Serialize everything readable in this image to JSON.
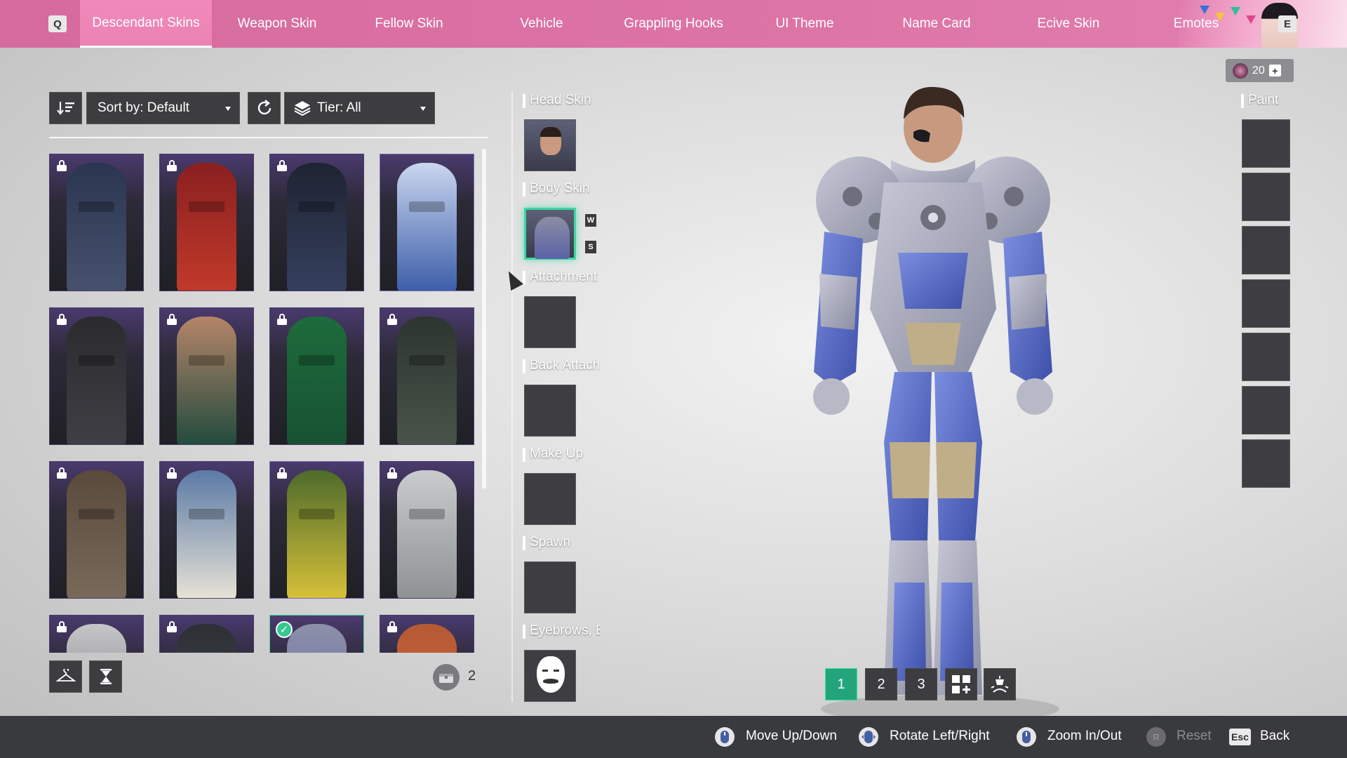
{
  "topbar": {
    "left_key": "Q",
    "right_key": "E",
    "tabs": [
      {
        "label": "Descendant Skins",
        "active": true
      },
      {
        "label": "Weapon Skin",
        "active": false
      },
      {
        "label": "Fellow Skin",
        "active": false
      },
      {
        "label": "Vehicle",
        "active": false
      },
      {
        "label": "Grappling Hooks",
        "active": false
      },
      {
        "label": "UI Theme",
        "active": false
      },
      {
        "label": "Name Card",
        "active": false
      },
      {
        "label": "Ecive Skin",
        "active": false
      },
      {
        "label": "Emotes",
        "active": false
      }
    ]
  },
  "filters": {
    "sort_label": "Sort by: Default",
    "tier_label": "Tier: All"
  },
  "skins": [
    {
      "locked": true,
      "equipped": false,
      "colors": [
        "#2a3550",
        "#47526e"
      ]
    },
    {
      "locked": true,
      "equipped": false,
      "colors": [
        "#8a1f1f",
        "#c23a2a"
      ]
    },
    {
      "locked": true,
      "equipped": false,
      "colors": [
        "#1f2433",
        "#35405e"
      ]
    },
    {
      "locked": false,
      "equipped": false,
      "colors": [
        "#c9d6ee",
        "#3a5ca8"
      ]
    },
    {
      "locked": true,
      "equipped": false,
      "colors": [
        "#2b2b2e",
        "#3f3f45"
      ]
    },
    {
      "locked": true,
      "equipped": false,
      "colors": [
        "#b58568",
        "#1f4a3d"
      ]
    },
    {
      "locked": true,
      "equipped": false,
      "colors": [
        "#1d6b3c",
        "#175232"
      ]
    },
    {
      "locked": true,
      "equipped": false,
      "colors": [
        "#2c3530",
        "#4a5449"
      ]
    },
    {
      "locked": true,
      "equipped": false,
      "colors": [
        "#5a4a3c",
        "#7a6a5a"
      ]
    },
    {
      "locked": true,
      "equipped": false,
      "colors": [
        "#5b7aa6",
        "#e9e4d6"
      ]
    },
    {
      "locked": true,
      "equipped": false,
      "colors": [
        "#4d6b2a",
        "#d9c23a"
      ]
    },
    {
      "locked": true,
      "equipped": false,
      "colors": [
        "#c9cbcc",
        "#8d9193"
      ]
    },
    {
      "locked": true,
      "equipped": false,
      "colors": [
        "#c6c6c8",
        "#6b6b70"
      ]
    },
    {
      "locked": true,
      "equipped": false,
      "colors": [
        "#2d2f35",
        "#4a4d55"
      ]
    },
    {
      "locked": false,
      "equipped": true,
      "colors": [
        "#8d90a8",
        "#5b63a8"
      ]
    },
    {
      "locked": true,
      "equipped": false,
      "colors": [
        "#b45a36",
        "#d8663a"
      ]
    }
  ],
  "storage": {
    "count": "2"
  },
  "slots": {
    "head_label": "Head Skin",
    "body_label": "Body Skin",
    "attachment_label": "Attachment",
    "back_label": "Back Attachment",
    "makeup_label": "Make Up",
    "spawn_label": "Spawn",
    "eyebrows_label": "Eyebrows, E",
    "body_key_up": "W",
    "body_key_down": "S"
  },
  "currency": {
    "amount": "20"
  },
  "paint": {
    "label": "Paint",
    "slot_count": 7
  },
  "presets": {
    "labels": [
      "1",
      "2",
      "3"
    ],
    "active": "1"
  },
  "controls": {
    "move": "Move Up/Down",
    "rotate": "Rotate Left/Right",
    "zoom": "Zoom In/Out",
    "reset_key": "R",
    "reset": "Reset",
    "back_key": "Esc",
    "back": "Back"
  },
  "colors": {
    "accent_pink": "#dd74a6",
    "select_green": "#3bd8a0",
    "panel_dark": "#3d3d40",
    "rare_purple": "#4a3a6e"
  }
}
